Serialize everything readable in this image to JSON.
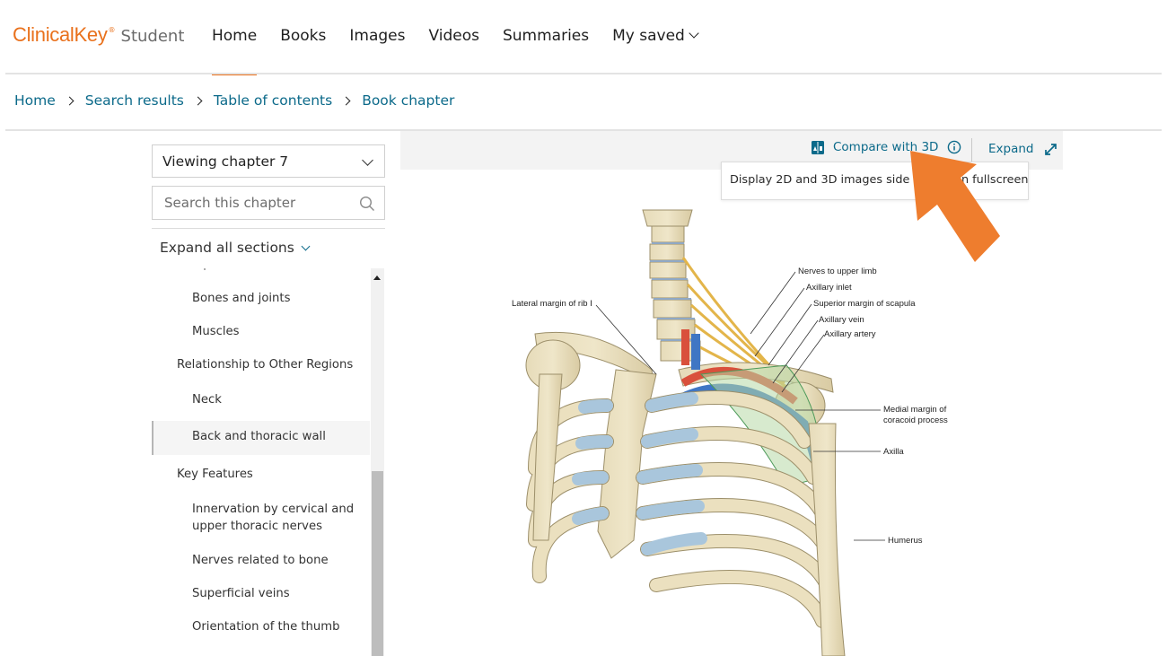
{
  "header": {
    "brand": "ClinicalKey",
    "brand_mark": "®",
    "product": "Student",
    "nav": [
      {
        "label": "Home",
        "active": true
      },
      {
        "label": "Books",
        "active": false
      },
      {
        "label": "Images",
        "active": false
      },
      {
        "label": "Videos",
        "active": false
      },
      {
        "label": "Summaries",
        "active": false
      },
      {
        "label": "My saved",
        "active": false,
        "dropdown": true
      }
    ]
  },
  "breadcrumb": [
    "Home",
    "Search results",
    "Table of contents",
    "Book chapter"
  ],
  "sidebar": {
    "chapter_select": "Viewing chapter 7",
    "search_placeholder": "Search this chapter",
    "expand_all": "Expand all sections",
    "toc": [
      {
        "label": "Bones and joints",
        "level": 2
      },
      {
        "label": "Muscles",
        "level": 2
      },
      {
        "label": "Relationship to Other Regions",
        "level": 1
      },
      {
        "label": "Neck",
        "level": 2
      },
      {
        "label": "Back and thoracic wall",
        "level": 2,
        "active": true
      },
      {
        "label": "Key Features",
        "level": 1
      },
      {
        "label": "Innervation by cervical and upper thoracic nerves",
        "level": 2
      },
      {
        "label": "Nerves related to bone",
        "level": 2
      },
      {
        "label": "Superficial veins",
        "level": 2
      },
      {
        "label": "Orientation of the thumb",
        "level": 2
      }
    ]
  },
  "viewer": {
    "compare_label": "Compare with 3D",
    "expand_label": "Expand",
    "tooltip": "Display 2D and 3D images side by side in fullscreen",
    "figure_labels": {
      "lateral_rib": "Lateral margin of rib I",
      "nerves_upper_limb": "Nerves to upper limb",
      "axillary_inlet": "Axillary inlet",
      "superior_scapula": "Superior margin of scapula",
      "axillary_vein": "Axillary vein",
      "axillary_artery": "Axillary artery",
      "medial_coracoid_1": "Medial margin of",
      "medial_coracoid_2": "coracoid process",
      "axilla": "Axilla",
      "humerus": "Humerus"
    }
  },
  "colors": {
    "brand_orange": "#e9711c",
    "link_teal": "#0c6a8a",
    "annotation_arrow": "#ee7d2e"
  }
}
